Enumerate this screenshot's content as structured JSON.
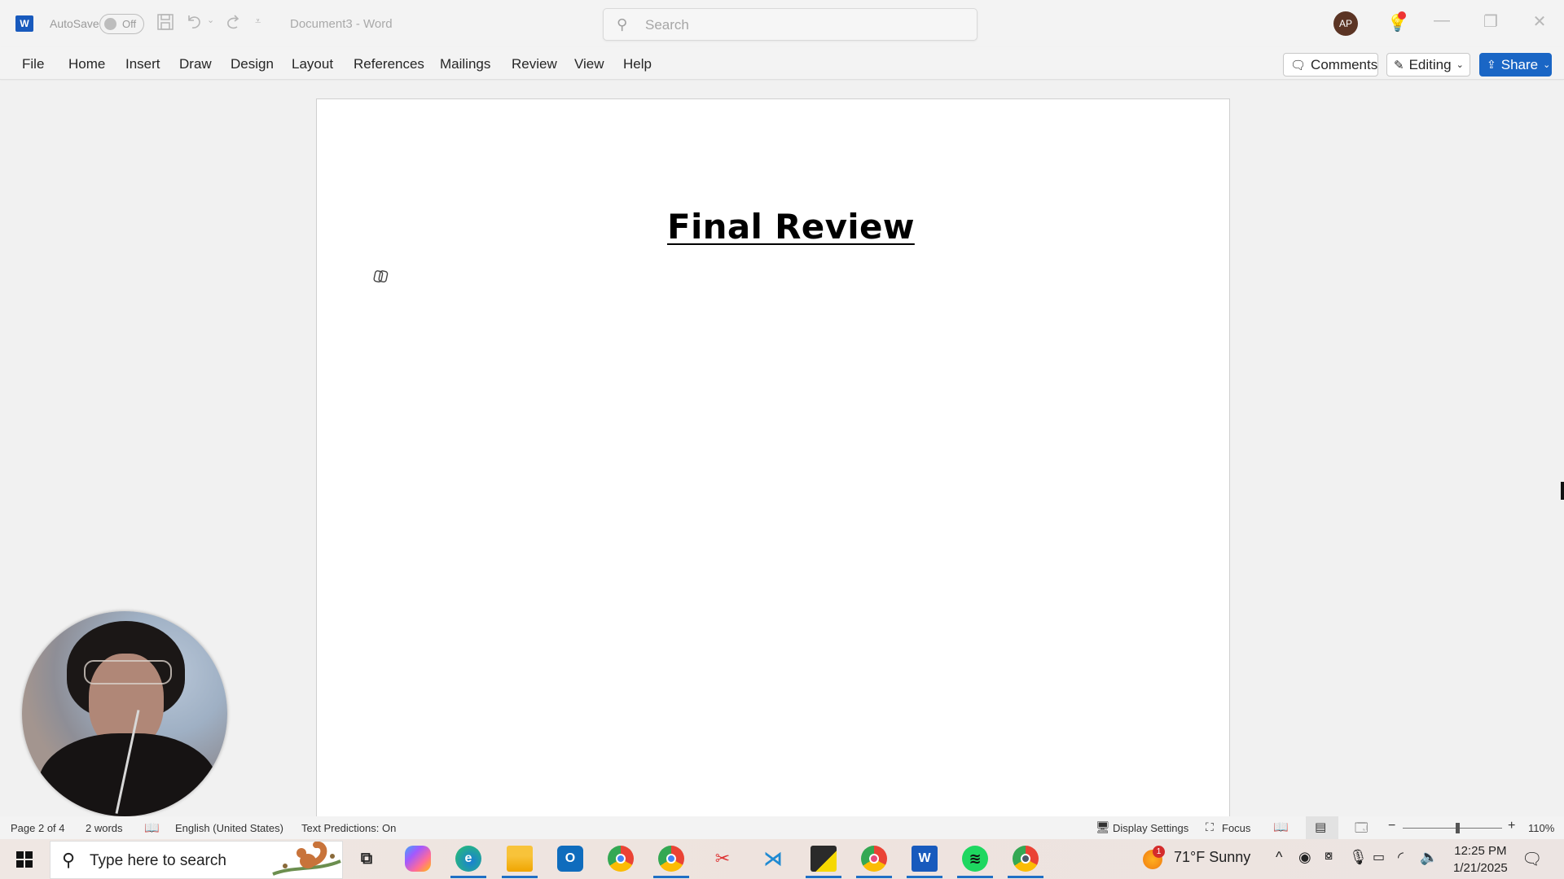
{
  "titlebar": {
    "app_icon": "word-logo-icon",
    "autosave_label": "AutoSave",
    "autosave_state": "Off",
    "document_title": "Document3  -  Word",
    "search_placeholder": "Search",
    "avatar_initials": "AP",
    "window_controls": [
      "minimize",
      "restore",
      "close"
    ]
  },
  "ribbon": {
    "tabs": [
      "File",
      "Home",
      "Insert",
      "Draw",
      "Design",
      "Layout",
      "References",
      "Mailings",
      "Review",
      "View",
      "Help"
    ],
    "comments_label": "Comments",
    "editing_label": "Editing",
    "share_label": "Share",
    "share_color": "#1a66c5"
  },
  "document": {
    "heading": "Final Review"
  },
  "statusbar": {
    "page": "Page 2 of 4",
    "words": "2 words",
    "language": "English (United States)",
    "text_predictions": "Text Predictions: On",
    "display_settings": "Display Settings",
    "focus": "Focus",
    "zoom_level": "110%",
    "zoom_fraction": 0.55
  },
  "taskbar": {
    "search_placeholder": "Type here to search",
    "apps": [
      "Task View",
      "Copilot",
      "Microsoft Edge",
      "File Explorer",
      "Outlook",
      "Google Chrome",
      "Chrome Profile",
      "Snipping Tool",
      "Visual Studio Code",
      "Sticky Notes",
      "Chrome Profile A",
      "Word",
      "Spotify",
      "Chrome Profile A2"
    ],
    "weather_badge": "1",
    "weather": "71°F  Sunny",
    "time": "12:25 PM",
    "date": "1/21/2025"
  }
}
